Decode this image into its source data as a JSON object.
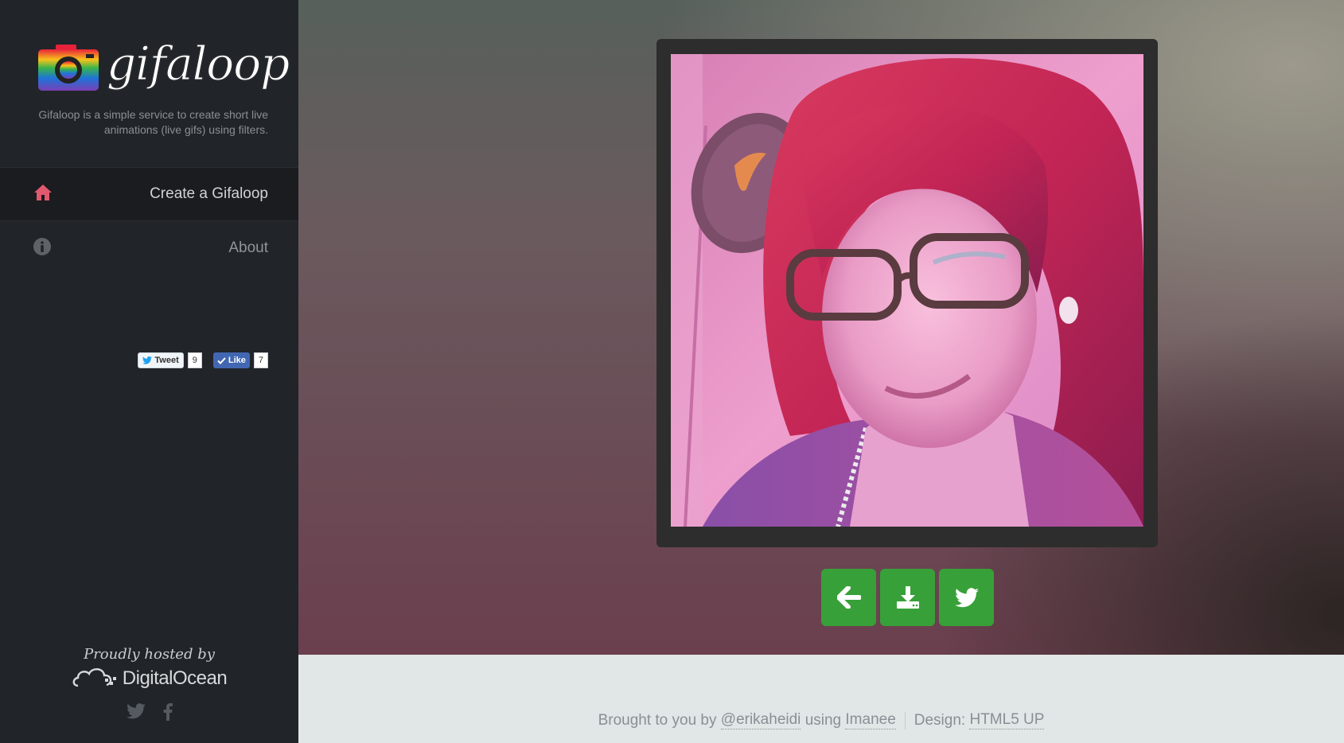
{
  "sidebar": {
    "logo_text": "gifaloop",
    "tagline": "Gifaloop is a simple service to create short live animations (live gifs) using filters.",
    "nav": [
      {
        "label": "Create a Gifaloop",
        "icon": "home-icon",
        "active": true
      },
      {
        "label": "About",
        "icon": "info-icon",
        "active": false
      }
    ],
    "share": {
      "tweet_label": "Tweet",
      "tweet_count": "9",
      "like_label": "Like",
      "like_count": "7"
    },
    "hosted": {
      "title": "Proudly hosted by",
      "brand": "DigitalOcean"
    },
    "social_icons": [
      "twitter-icon",
      "facebook-icon"
    ]
  },
  "main": {
    "actions": [
      {
        "name": "back-button",
        "icon": "arrow-left-icon"
      },
      {
        "name": "download-button",
        "icon": "download-icon"
      },
      {
        "name": "tweet-gif-button",
        "icon": "twitter-icon"
      }
    ]
  },
  "footer": {
    "prefix": "Brought to you by",
    "author": "@erikaheidi",
    "using": "using",
    "tool": "Imanee",
    "design_label": "Design:",
    "design_link": "HTML5 UP"
  },
  "colors": {
    "sidebar_bg": "#212428",
    "accent_home": "#e0596e",
    "action_green": "#38a038",
    "footer_bg": "#e1e6e6"
  }
}
